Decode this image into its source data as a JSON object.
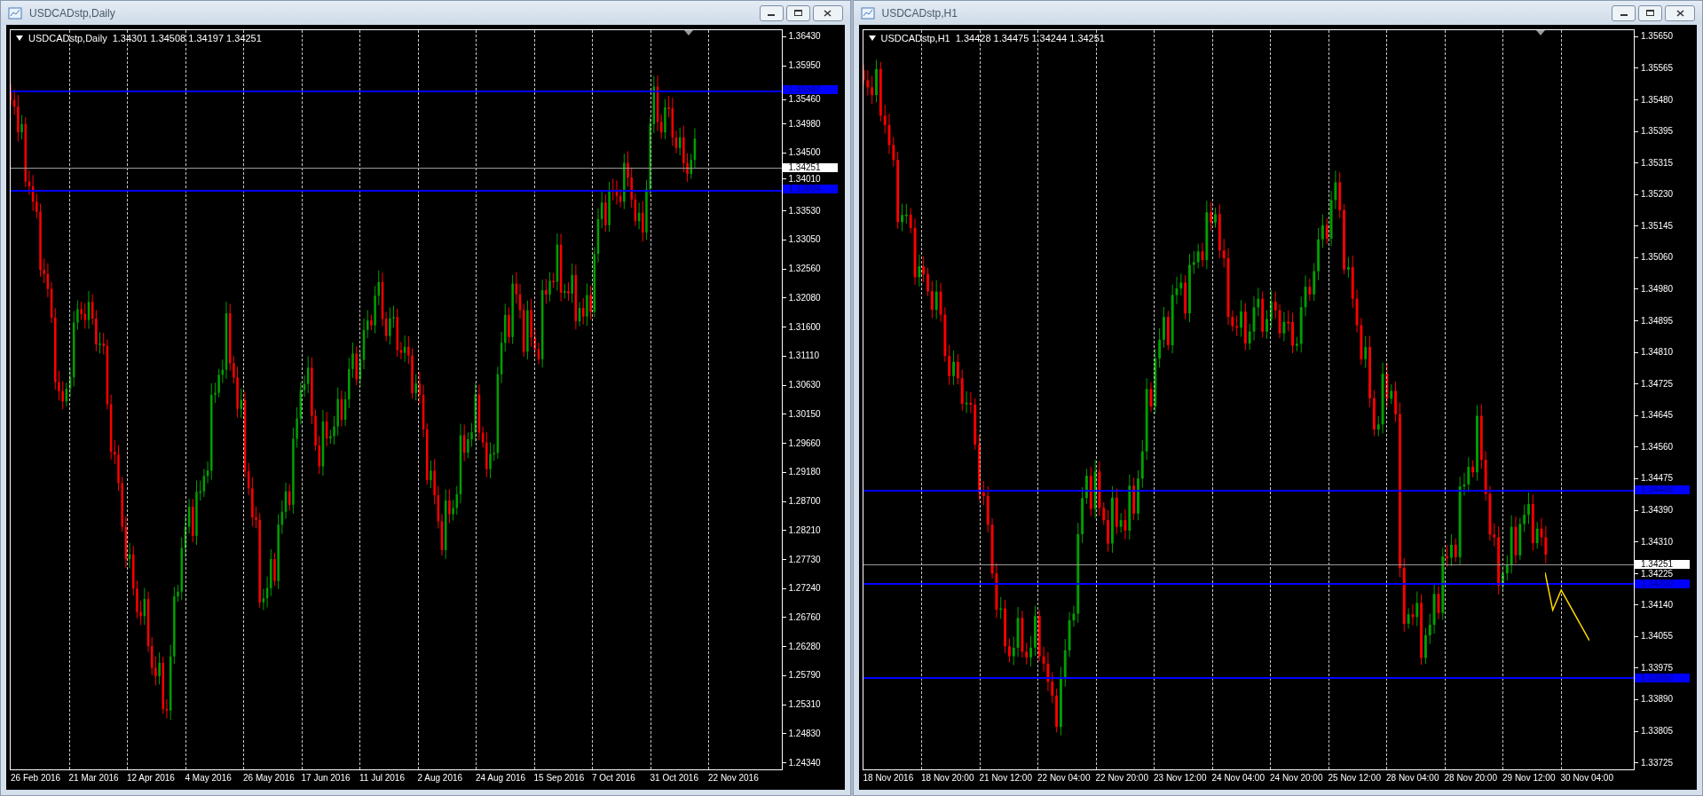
{
  "windows": [
    {
      "title": "USDCADstp,Daily",
      "symbol": "USDCADstp,Daily",
      "ohlc": "1.34301 1.34508 1.34197 1.34251",
      "current_price": "1.34251",
      "forecast_line": false,
      "price_ticks": [
        "1.36430",
        "1.35950",
        "1.35460",
        "1.34980",
        "1.34500",
        "1.34010",
        "1.33530",
        "1.33050",
        "1.32560",
        "1.32080",
        "1.31600",
        "1.31110",
        "1.30630",
        "1.30150",
        "1.29660",
        "1.29180",
        "1.28700",
        "1.28210",
        "1.27730",
        "1.27240",
        "1.26760",
        "1.26280",
        "1.25790",
        "1.25310",
        "1.24830",
        "1.24340"
      ],
      "levels": [
        {
          "label": "1.35547"
        },
        {
          "label": "1.33894"
        }
      ],
      "time_labels": [
        "26 Feb 2016",
        "21 Mar 2016",
        "12 Apr 2016",
        "4 May 2016",
        "26 May 2016",
        "17 Jun 2016",
        "11 Jul 2016",
        "2 Aug 2016",
        "24 Aug 2016",
        "15 Sep 2016",
        "7 Oct 2016",
        "31 Oct 2016",
        "22 Nov 2016"
      ]
    },
    {
      "title": "USDCADstp,H1",
      "symbol": "USDCADstp,H1",
      "ohlc": "1.34428 1.34475 1.34244 1.34251",
      "current_price": "1.34251",
      "forecast_line": true,
      "price_ticks": [
        "1.35650",
        "1.35565",
        "1.35480",
        "1.35395",
        "1.35315",
        "1.35230",
        "1.35145",
        "1.35060",
        "1.34980",
        "1.34895",
        "1.34810",
        "1.34725",
        "1.34645",
        "1.34560",
        "1.34475",
        "1.34390",
        "1.34310",
        "1.34225",
        "1.34140",
        "1.34055",
        "1.33975",
        "1.33890",
        "1.33805",
        "1.33725"
      ],
      "levels": [
        {
          "label": "1.34449"
        },
        {
          "label": "1.34200"
        },
        {
          "label": "1.33950"
        }
      ],
      "time_labels": [
        "18 Nov 2016",
        "18 Nov 20:00",
        "21 Nov 12:00",
        "22 Nov 04:00",
        "22 Nov 20:00",
        "23 Nov 12:00",
        "24 Nov 04:00",
        "24 Nov 20:00",
        "25 Nov 12:00",
        "28 Nov 04:00",
        "28 Nov 20:00",
        "29 Nov 12:00",
        "30 Nov 04:00"
      ]
    }
  ]
}
